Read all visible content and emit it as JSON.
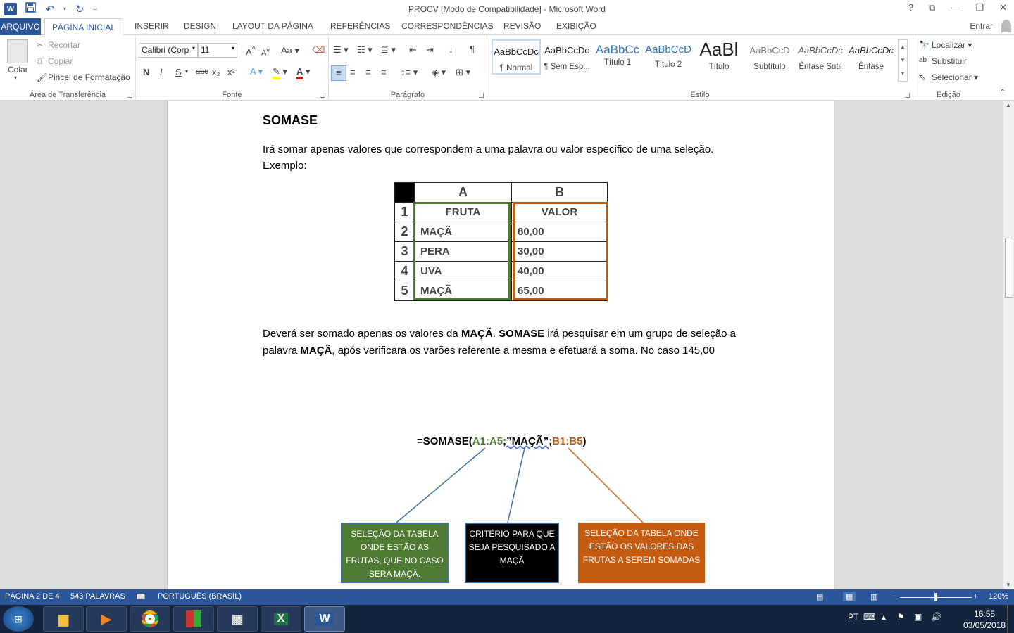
{
  "window": {
    "title": "PROCV [Modo de Compatibilidade] - Microsoft Word",
    "help": "?",
    "restore_ribbon": "⧉",
    "minimize": "—",
    "maximize": "❐",
    "close": "✕"
  },
  "qat": {
    "app_icon": "W",
    "save_icon": "save-icon",
    "undo_icon": "undo-icon",
    "redo_icon": "redo-icon"
  },
  "tabs": {
    "file": "ARQUIVO",
    "active": "PÁGINA INICIAL",
    "items": [
      "INSERIR",
      "DESIGN",
      "LAYOUT DA PÁGINA",
      "REFERÊNCIAS",
      "CORRESPONDÊNCIAS",
      "REVISÃO",
      "EXIBIÇÃO"
    ],
    "signin": "Entrar"
  },
  "clipboard": {
    "paste": "Colar",
    "cut": "Recortar",
    "copy": "Copiar",
    "format_painter": "Pincel de Formatação",
    "label": "Área de Transferência"
  },
  "font": {
    "name": "Calibri (Corp",
    "size": "11",
    "label": "Fonte",
    "bold": "N",
    "italic": "I",
    "underline": "S",
    "strike": "abc",
    "sub": "x₂",
    "sup": "x²",
    "grow": "A",
    "shrink": "A",
    "case": "Aa"
  },
  "paragraph": {
    "label": "Parágrafo",
    "pilcrow": "¶"
  },
  "styles": {
    "label": "Estilo",
    "items": [
      {
        "preview": "AaBbCcDc",
        "name": "¶ Normal"
      },
      {
        "preview": "AaBbCcDc",
        "name": "¶ Sem Esp..."
      },
      {
        "preview": "AaBbCc",
        "name": "Título 1"
      },
      {
        "preview": "AaBbCcD",
        "name": "Título 2"
      },
      {
        "preview": "AaBl",
        "name": "Título"
      },
      {
        "preview": "AaBbCcD",
        "name": "Subtítulo"
      },
      {
        "preview": "AaBbCcDc",
        "name": "Ênfase Sutil"
      },
      {
        "preview": "AaBbCcDc",
        "name": "Ênfase"
      }
    ]
  },
  "editing": {
    "label": "Edição",
    "find": "Localizar",
    "replace": "Substituir",
    "select": "Selecionar"
  },
  "document": {
    "heading": "SOMASE",
    "intro": "Irá somar apenas valores que correspondem a uma palavra ou valor especifico de uma seleção. Exemplo:",
    "table": {
      "col_headers": [
        "A",
        "B"
      ],
      "rows": [
        {
          "n": "1",
          "a": "FRUTA",
          "b": "VALOR"
        },
        {
          "n": "2",
          "a": "MAÇÃ",
          "b": "80,00"
        },
        {
          "n": "3",
          "a": "PERA",
          "b": "30,00"
        },
        {
          "n": "4",
          "a": "UVA",
          "b": "40,00"
        },
        {
          "n": "5",
          "a": "MAÇÃ",
          "b": "65,00"
        }
      ]
    },
    "para": {
      "t1": "Deverá ser somado apenas os valores da ",
      "b1": "MAÇÃ",
      "t2": ". ",
      "b2": "SOMASE",
      "t3": " irá pesquisar em um grupo de seleção a palavra ",
      "b3": "MAÇÃ",
      "t4": ", após verificara os varões referente a mesma e efetuará a soma. No caso 145,00"
    },
    "formula": {
      "prefix": "=SOMASE(",
      "range1": "A1:A5",
      "sep1": ";”MAÇÃ”;",
      "range2": "B1:B5",
      "suffix": ")"
    },
    "callouts": {
      "left": "SELEÇÃO DA TABELA ONDE ESTÃO AS FRUTAS, QUE NO CASO SERA MAÇÃ.",
      "middle": "CRITÉRIO PARA QUE SEJA PESQUISADO A MAÇÃ",
      "right": "SELEÇÃO DA TABELA ONDE ESTÃO OS VALORES DAS FRUTAS A SEREM SOMADAS"
    },
    "colors": {
      "green": "#4e7a33",
      "orange": "#c55a11",
      "blue_line": "#41719c"
    }
  },
  "status": {
    "page": "PÁGINA 2 DE 4",
    "words": "543 PALAVRAS",
    "language": "PORTUGUÊS (BRASIL)",
    "zoom": "120%"
  },
  "taskbar": {
    "lang": "PT",
    "time": "16:55",
    "date": "03/05/2018"
  }
}
